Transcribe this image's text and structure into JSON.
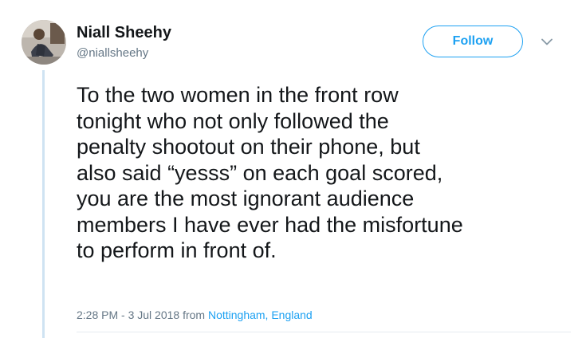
{
  "tweet": {
    "author": {
      "name": "Niall Sheehy",
      "handle": "@niallsheehy"
    },
    "follow_label": "Follow",
    "text": "To the two women in the front row\ntonight who not only followed the\npenalty shootout on their phone, but\nalso said “yesss” on each goal scored,\nyou are the most ignorant audience\nmembers I have ever had the misfortune\nto perform in front of.",
    "timestamp": "2:28 PM - 3 Jul 2018",
    "from_label": "from",
    "location": "Nottingham, England"
  },
  "icons": {
    "more": "chevron-down-icon"
  },
  "colors": {
    "accent": "#1da1f2",
    "text": "#14171a",
    "muted": "#657786",
    "thread_line": "#cfe3f2"
  }
}
